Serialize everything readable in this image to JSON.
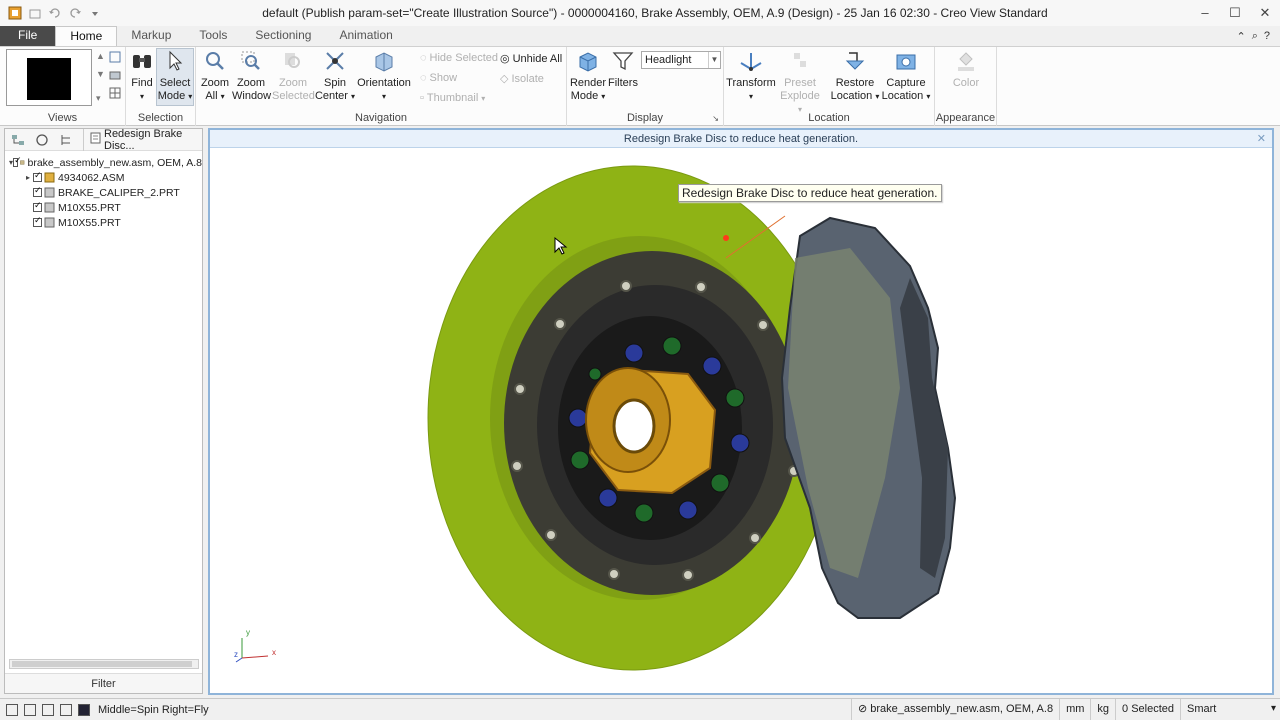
{
  "window": {
    "title": "default (Publish param-set=\"Create Illustration Source\") - 0000004160, Brake Assembly, OEM, A.9 (Design) - 25 Jan 16 02:30 - Creo View Standard"
  },
  "tabs": [
    {
      "label": "File"
    },
    {
      "label": "Home"
    },
    {
      "label": "Markup"
    },
    {
      "label": "Tools"
    },
    {
      "label": "Sectioning"
    },
    {
      "label": "Animation"
    }
  ],
  "ribbon": {
    "groups": {
      "views": "Views",
      "selection": "Selection",
      "navigation": "Navigation",
      "display": "Display",
      "location": "Location",
      "appearance": "Appearance"
    },
    "find": "Find",
    "select_mode": [
      "Select",
      "Mode"
    ],
    "zoom_all": [
      "Zoom",
      "All"
    ],
    "zoom_window": [
      "Zoom",
      "Window"
    ],
    "zoom_selected": [
      "Zoom",
      "Selected"
    ],
    "spin_center": [
      "Spin",
      "Center"
    ],
    "orientation": "Orientation",
    "hide_selected": "Hide Selected",
    "show": "Show",
    "thumbnail": "Thumbnail",
    "unhide_all": "Unhide All",
    "isolate": "Isolate",
    "render_mode": [
      "Render",
      "Mode"
    ],
    "filters": "Filters",
    "lighting_value": "Headlight",
    "transform": "Transform",
    "preset_explode": [
      "Preset",
      "Explode"
    ],
    "restore_location": [
      "Restore",
      "Location"
    ],
    "capture_location": [
      "Capture",
      "Location"
    ],
    "color": "Color"
  },
  "left_panel": {
    "tab_label": "Redesign Brake Disc...",
    "tree": [
      {
        "label": "brake_assembly_new.asm, OEM, A.8",
        "level": 0,
        "expanded": true
      },
      {
        "label": "4934062.ASM",
        "level": 1,
        "expanded": false
      },
      {
        "label": "BRAKE_CALIPER_2.PRT",
        "level": 1
      },
      {
        "label": "M10X55.PRT",
        "level": 1
      },
      {
        "label": "M10X55.PRT",
        "level": 1
      }
    ],
    "filter_label": "Filter"
  },
  "viewport": {
    "message": "Redesign Brake Disc to reduce heat generation.",
    "callout": "Redesign Brake Disc to reduce heat generation.",
    "axes": {
      "x": "x",
      "y": "y",
      "z": "z"
    }
  },
  "status": {
    "mouse_hint": "Middle=Spin   Right=Fly",
    "model": "brake_assembly_new.asm, OEM, A.8",
    "length_unit": "mm",
    "mass_unit": "kg",
    "selected": "0 Selected",
    "filter_mode": "Smart"
  },
  "colors": {
    "disc": "#8fb315",
    "accent": "#8fb4d9",
    "file_tab": "#4a4a4a"
  }
}
